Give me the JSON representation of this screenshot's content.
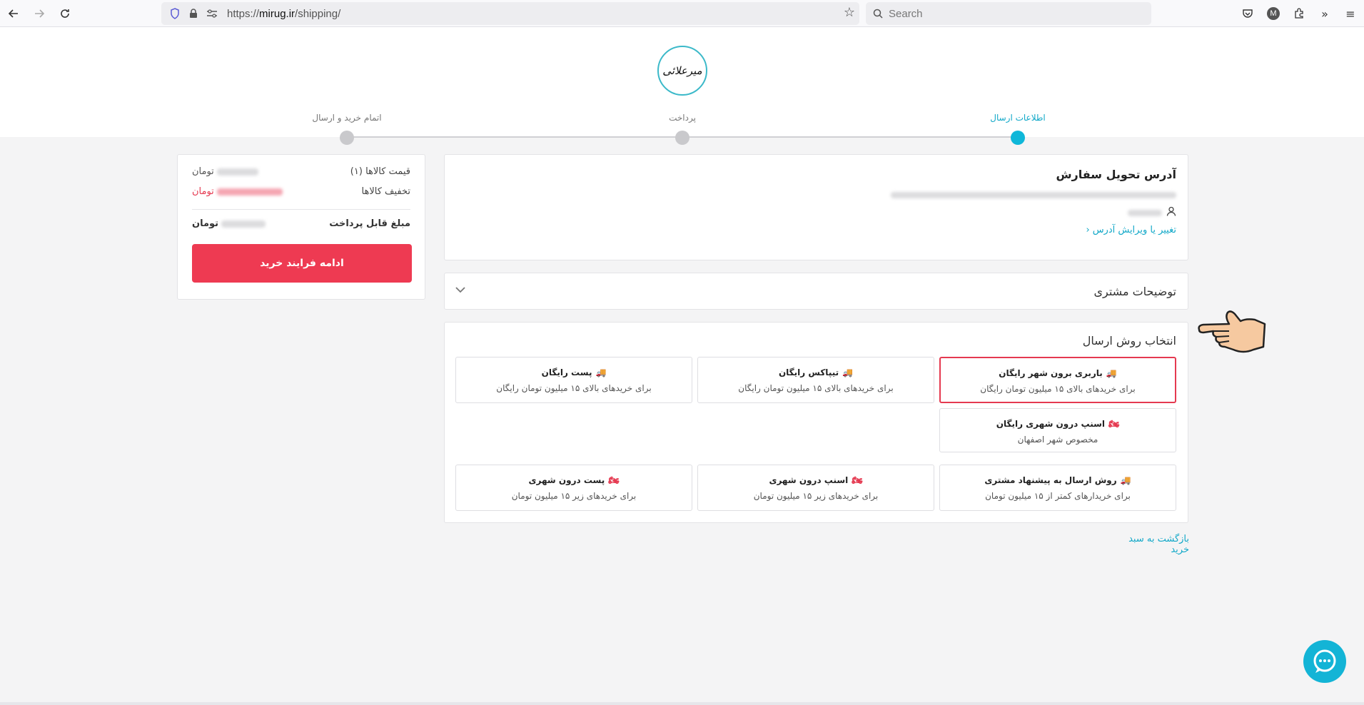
{
  "browser": {
    "url_prefix": "https://",
    "url_host": "mirug.ir",
    "url_path": "/shipping/",
    "search_placeholder": "Search",
    "avatar_letter": "M"
  },
  "header": {
    "logo_text": "میرعلائی",
    "steps": [
      {
        "label": "اطلاعات ارسال",
        "active": true
      },
      {
        "label": "پرداخت",
        "active": false
      },
      {
        "label": "اتمام خرید و ارسال",
        "active": false
      }
    ]
  },
  "summary": {
    "items_price_label": "قیمت کالاها (۱)",
    "items_price_currency": "تومان",
    "discount_label": "تخفیف کالاها",
    "discount_currency": "تومان",
    "payable_label": "مبلغ قابل پرداخت",
    "payable_currency": "تومان",
    "continue_button": "ادامه فرایند خرید"
  },
  "address": {
    "title": "آدرس تحویل سفارش",
    "edit_link": "تغییر یا ویرایش آدرس"
  },
  "notes": {
    "title": "توضیحات مشتری"
  },
  "shipping": {
    "title": "انتخاب روش ارسال",
    "options": [
      {
        "title": "باربری برون شهر رایگان",
        "subtitle": "برای خریدهای بالای ۱۵ میلیون تومان رایگان",
        "icon": "truck-icon",
        "selected": true
      },
      {
        "title": "تیپاکس رایگان",
        "subtitle": "برای خریدهای بالای ۱۵ میلیون تومان رایگان",
        "icon": "truck-icon",
        "selected": false
      },
      {
        "title": "پست رایگان",
        "subtitle": "برای خریدهای بالای ۱۵ میلیون تومان رایگان",
        "icon": "truck-icon",
        "selected": false
      },
      {
        "title": "اسنپ درون شهری رایگان",
        "subtitle": "مخصوص شهر اصفهان",
        "icon": "motorcycle-icon",
        "selected": false
      },
      {
        "title": "روش ارسال به پیشنهاد مشتری",
        "subtitle": "برای خریدارهای کمتر از ۱۵ میلیون تومان",
        "icon": "truck-icon",
        "selected": false
      },
      {
        "title": "اسنپ درون شهری",
        "subtitle": "برای خریدهای زیر ۱۵ میلیون تومان",
        "icon": "motorcycle-icon",
        "selected": false
      },
      {
        "title": "پست درون شهری",
        "subtitle": "برای خریدهای زیر ۱۵ میلیون تومان",
        "icon": "motorcycle-icon",
        "selected": false
      }
    ]
  },
  "back_link": "بازگشت به سبد خرید",
  "colors": {
    "accent": "#11a8c8",
    "primary_button": "#ee3a52",
    "selected_border": "#e53950"
  }
}
